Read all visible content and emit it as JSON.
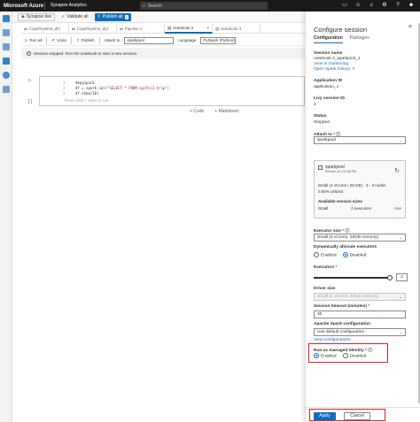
{
  "topbar": {
    "brand": "Microsoft Azure",
    "workspace": "Synapse Analytics",
    "search_placeholder": "Search"
  },
  "publish_bar": {
    "mode": "Synapse live",
    "validate_label": "Validate all",
    "publish_label": "Publish all",
    "publish_count": "6"
  },
  "tabs": [
    {
      "label": "CopyPipeline_dt7"
    },
    {
      "label": "CopyPipeline_dyz"
    },
    {
      "label": "Pipeline 2"
    },
    {
      "label": "Notebook 2"
    },
    {
      "label": "Notebook 3"
    }
  ],
  "toolbar": {
    "run_all": "Run all",
    "undo": "Undo",
    "publish": "Publish",
    "attach_to_label": "Attach to",
    "attach_to_value": "sparkpool",
    "language_label": "Language",
    "language_value": "PySpark (Python)"
  },
  "banner": {
    "message": "Session stopped. Run the notebook to start a new session."
  },
  "cell": {
    "line_numbers": [
      "1",
      "2",
      "3"
    ],
    "code_line_1": "%%pyspark",
    "code_line_2_a": "df = spark.sql(",
    "code_line_2_b": "\"SELECT * FROM nyctlc1.trip\"",
    "code_line_2_c": ")",
    "code_line_3": "df.show(10)",
    "hint": "Press shift + enter to run",
    "bracket": "[ ]"
  },
  "add_cell": {
    "code": "+ Code",
    "markdown": "+ Markdown"
  },
  "panel": {
    "title": "Configure session",
    "tabs": {
      "configuration": "Configuration",
      "packages": "Packages"
    },
    "session_name_label": "Session name",
    "session_name_value": "notebook 2_sparkpool_1",
    "view_monitoring": "View in monitoring",
    "open_spark_history": "Open Spark history",
    "application_id_label": "Application ID",
    "application_id_value": "application_1",
    "livy_id_label": "Livy session ID",
    "livy_id_value": "2",
    "status_label": "Status",
    "status_value": "Stopped",
    "attach_to_label": "Attach to",
    "attach_to_value": "sparkpool",
    "pool": {
      "name": "sparkpool",
      "refreshed": "Refresh at 2:37:56 PM",
      "spec": "Small (4 vCores / 28 GB) · 3 - 3 nodes",
      "utilization": "0.00% utilized",
      "sizes_label": "Available session sizes",
      "size_name": "Small",
      "size_executors": "2 executors",
      "use_label": "Use"
    },
    "executor_size_label": "Executor size",
    "executor_size_value": "Small (4 vCores, 28GB memory)",
    "dynamic_alloc_label": "Dynamically allocate executors",
    "dynamic_enabled": "Enabled",
    "dynamic_disabled": "Disabled",
    "executors_label": "Executors",
    "executors_value": "2",
    "driver_size_label": "Driver size",
    "driver_size_value": "Small (4 vCores, 28GB memory)",
    "timeout_label": "Session timeout (minutes)",
    "timeout_value": "30",
    "spark_config_label": "Apache Spark configuration",
    "spark_config_value": "Use default configuration",
    "view_configurations": "View configurations",
    "managed_identity_label": "Run as managed identity",
    "managed_enabled": "Enabled",
    "managed_disabled": "Disabled",
    "apply_label": "Apply",
    "cancel_label": "Cancel"
  },
  "colors": {
    "accent": "#0f6cbd",
    "topbar": "#1b1a19",
    "highlight": "#e0201b"
  }
}
